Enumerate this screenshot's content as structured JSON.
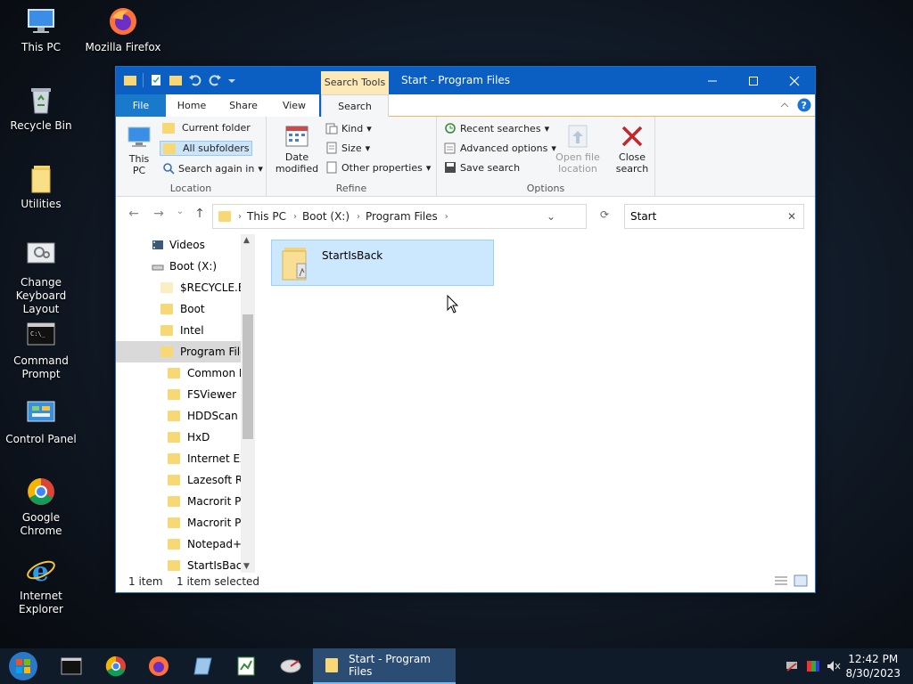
{
  "desktop": {
    "icons": [
      {
        "label": "This PC"
      },
      {
        "label": "Mozilla Firefox"
      },
      {
        "label": "Recycle Bin"
      },
      {
        "label": "Utilities"
      },
      {
        "label": "Change Keyboard Layout"
      },
      {
        "label": "Command Prompt"
      },
      {
        "label": "Control Panel"
      },
      {
        "label": "Google Chrome"
      },
      {
        "label": "Internet Explorer"
      }
    ]
  },
  "window": {
    "title": "Start - Program Files",
    "contextual_tab": "Search Tools",
    "tabs": [
      "File",
      "Home",
      "Share",
      "View",
      "Search"
    ],
    "ribbon": {
      "location": {
        "label": "Location",
        "this_pc": "This PC",
        "current_folder": "Current folder",
        "all_subfolders": "All subfolders",
        "search_again": "Search again in"
      },
      "refine": {
        "label": "Refine",
        "date_modified": "Date modified",
        "kind": "Kind",
        "size": "Size",
        "other_properties": "Other properties"
      },
      "options": {
        "label": "Options",
        "recent_searches": "Recent searches",
        "advanced_options": "Advanced options",
        "save_search": "Save search",
        "open_file_location": "Open file location"
      },
      "close_search": "Close search"
    },
    "address": {
      "crumbs": [
        "This PC",
        "Boot (X:)",
        "Program Files"
      ]
    },
    "search": {
      "value": "Start"
    },
    "nav_pane": [
      {
        "label": "Videos"
      },
      {
        "label": "Boot (X:)"
      },
      {
        "label": "$RECYCLE.BIN"
      },
      {
        "label": "Boot"
      },
      {
        "label": "Intel"
      },
      {
        "label": "Program Files"
      },
      {
        "label": "Common Fi"
      },
      {
        "label": "FSViewer"
      },
      {
        "label": "HDDScan"
      },
      {
        "label": "HxD"
      },
      {
        "label": "Internet Exp"
      },
      {
        "label": "Lazesoft Rec"
      },
      {
        "label": "Macrorit Pa"
      },
      {
        "label": "Macrorit Pa"
      },
      {
        "label": "Notepad++"
      },
      {
        "label": "StartIsBack"
      }
    ],
    "results": [
      {
        "name": "StartIsBack"
      }
    ],
    "status": {
      "count": "1 item",
      "selected": "1 item selected"
    }
  },
  "taskbar": {
    "active_window": "Start - Program Files",
    "time": "12:42 PM",
    "date": "8/30/2023"
  }
}
